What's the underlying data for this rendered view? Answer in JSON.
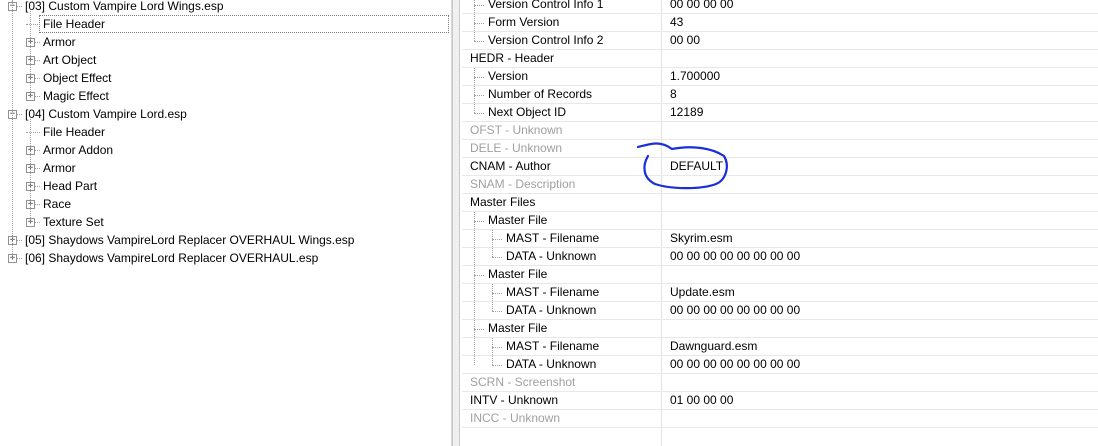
{
  "tree": {
    "nodes": [
      {
        "label": "[03] Custom Vampire Lord Wings.esp",
        "level": 0,
        "expander": "minus"
      },
      {
        "label": "File Header",
        "level": 1,
        "expander": "none",
        "selected": true
      },
      {
        "label": "Armor",
        "level": 1,
        "expander": "plus"
      },
      {
        "label": "Art Object",
        "level": 1,
        "expander": "plus"
      },
      {
        "label": "Object Effect",
        "level": 1,
        "expander": "plus"
      },
      {
        "label": "Magic Effect",
        "level": 1,
        "expander": "plus"
      },
      {
        "label": "[04] Custom Vampire Lord.esp",
        "level": 0,
        "expander": "minus"
      },
      {
        "label": "File Header",
        "level": 1,
        "expander": "none"
      },
      {
        "label": "Armor Addon",
        "level": 1,
        "expander": "plus"
      },
      {
        "label": "Armor",
        "level": 1,
        "expander": "plus"
      },
      {
        "label": "Head Part",
        "level": 1,
        "expander": "plus"
      },
      {
        "label": "Race",
        "level": 1,
        "expander": "plus"
      },
      {
        "label": "Texture Set",
        "level": 1,
        "expander": "plus"
      },
      {
        "label": "[05] Shaydows VampireLord Replacer OVERHAUL Wings.esp",
        "level": 0,
        "expander": "plus"
      },
      {
        "label": "[06] Shaydows VampireLord Replacer OVERHAUL.esp",
        "level": 0,
        "expander": "plus"
      }
    ]
  },
  "details": {
    "rows": [
      {
        "label": "Version Control Info 1",
        "value": "00 00 00 00",
        "indent": 1,
        "gray": false
      },
      {
        "label": "Form Version",
        "value": "43",
        "indent": 1,
        "gray": false
      },
      {
        "label": "Version Control Info 2",
        "value": "00 00",
        "indent": 1,
        "gray": false
      },
      {
        "label": "HEDR - Header",
        "value": "",
        "indent": 0,
        "gray": false
      },
      {
        "label": "Version",
        "value": "1.700000",
        "indent": 1,
        "gray": false
      },
      {
        "label": "Number of Records",
        "value": "8",
        "indent": 1,
        "gray": false
      },
      {
        "label": "Next Object ID",
        "value": "12189",
        "indent": 1,
        "gray": false
      },
      {
        "label": "OFST - Unknown",
        "value": "",
        "indent": 0,
        "gray": true
      },
      {
        "label": "DELE - Unknown",
        "value": "",
        "indent": 0,
        "gray": true
      },
      {
        "label": "CNAM - Author",
        "value": "DEFAULT",
        "indent": 0,
        "gray": false
      },
      {
        "label": "SNAM - Description",
        "value": "",
        "indent": 0,
        "gray": true
      },
      {
        "label": "Master Files",
        "value": "",
        "indent": 0,
        "gray": false
      },
      {
        "label": "Master File",
        "value": "",
        "indent": 1,
        "gray": false
      },
      {
        "label": "MAST - Filename",
        "value": "Skyrim.esm",
        "indent": 2,
        "gray": false
      },
      {
        "label": "DATA - Unknown",
        "value": "00 00 00 00 00 00 00 00",
        "indent": 2,
        "gray": false
      },
      {
        "label": "Master File",
        "value": "",
        "indent": 1,
        "gray": false
      },
      {
        "label": "MAST - Filename",
        "value": "Update.esm",
        "indent": 2,
        "gray": false
      },
      {
        "label": "DATA - Unknown",
        "value": "00 00 00 00 00 00 00 00",
        "indent": 2,
        "gray": false
      },
      {
        "label": "Master File",
        "value": "",
        "indent": 1,
        "gray": false
      },
      {
        "label": "MAST - Filename",
        "value": "Dawnguard.esm",
        "indent": 2,
        "gray": false
      },
      {
        "label": "DATA - Unknown",
        "value": "00 00 00 00 00 00 00 00",
        "indent": 2,
        "gray": false
      },
      {
        "label": "SCRN - Screenshot",
        "value": "",
        "indent": 0,
        "gray": true
      },
      {
        "label": "INTV - Unknown",
        "value": "01 00 00 00",
        "indent": 0,
        "gray": false
      },
      {
        "label": "INCC - Unknown",
        "value": "",
        "indent": 0,
        "gray": true
      }
    ]
  },
  "colors": {
    "annotation": "#1a2fd6",
    "disabled_text": "#a0a0a0"
  },
  "annotation": {
    "highlighted_field": "CNAM - Author",
    "shape": "hand-drawn-circle"
  }
}
